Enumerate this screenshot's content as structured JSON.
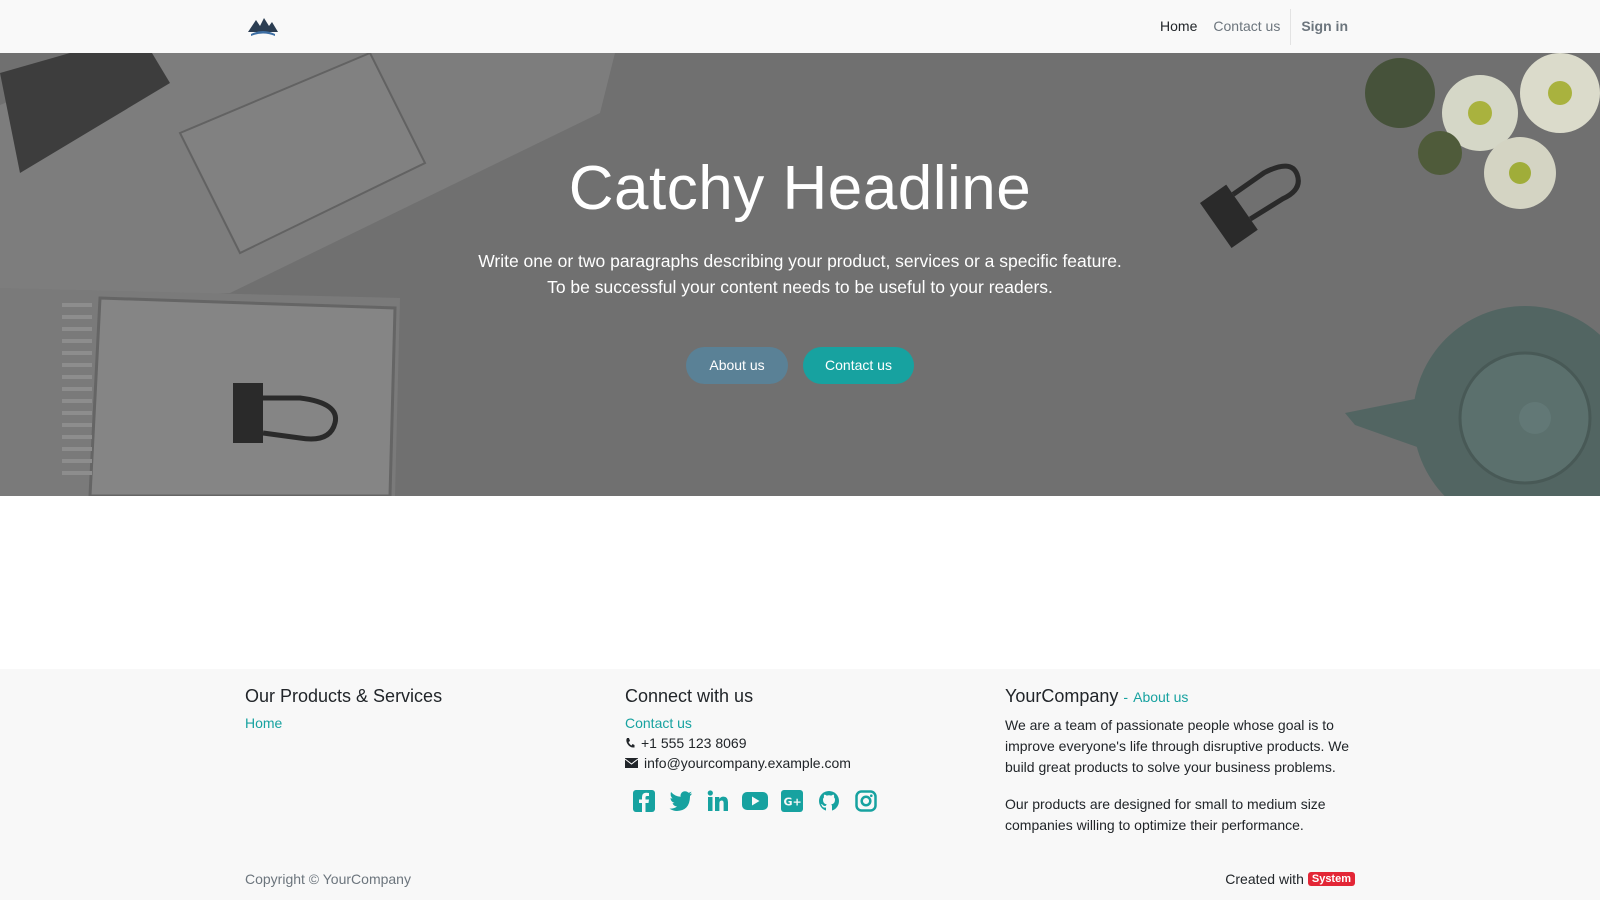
{
  "header": {
    "nav": {
      "home": "Home",
      "contact": "Contact us",
      "signin": "Sign in"
    }
  },
  "hero": {
    "title": "Catchy Headline",
    "paragraph_line1": "Write one or two paragraphs describing your product, services or a specific feature.",
    "paragraph_line2": "To be successful your content needs to be useful to your readers.",
    "buttons": {
      "about": "About us",
      "contact": "Contact us"
    }
  },
  "footer": {
    "products": {
      "heading": "Our Products & Services",
      "home_link": "Home"
    },
    "connect": {
      "heading": "Connect with us",
      "contact_link": "Contact us",
      "phone": "+1 555 123 8069",
      "email": "info@yourcompany.example.com",
      "social_icons": [
        "facebook-icon",
        "twitter-icon",
        "linkedin-icon",
        "youtube-icon",
        "google-plus-icon",
        "github-icon",
        "instagram-icon"
      ]
    },
    "company": {
      "name": "YourCompany",
      "dash": "-",
      "about_link": "About us",
      "paragraph1": "We are a team of passionate people whose goal is to improve everyone's life through disruptive products. We build great products to solve your business problems.",
      "paragraph2": "Our products are designed for small to medium size companies willing to optimize their performance."
    },
    "copyright": "Copyright © YourCompany",
    "created_with": "Created with",
    "badge": "System"
  },
  "colors": {
    "accent": "#17a2a0",
    "about_button": "#5a8196",
    "hero_overlay": "#7b7b7b",
    "badge": "#e32636"
  }
}
